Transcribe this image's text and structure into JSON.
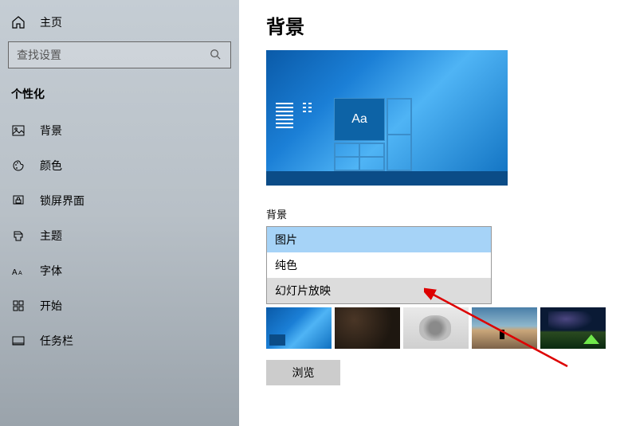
{
  "sidebar": {
    "home": "主页",
    "search_placeholder": "查找设置",
    "category": "个性化",
    "items": [
      {
        "label": "背景"
      },
      {
        "label": "颜色"
      },
      {
        "label": "锁屏界面"
      },
      {
        "label": "主题"
      },
      {
        "label": "字体"
      },
      {
        "label": "开始"
      },
      {
        "label": "任务栏"
      }
    ]
  },
  "main": {
    "title": "背景",
    "preview_tile_text": "Aa",
    "bg_label": "背景",
    "dropdown": [
      {
        "label": "图片",
        "state": "selected"
      },
      {
        "label": "纯色",
        "state": ""
      },
      {
        "label": "幻灯片放映",
        "state": "hovered"
      }
    ],
    "browse": "浏览"
  }
}
